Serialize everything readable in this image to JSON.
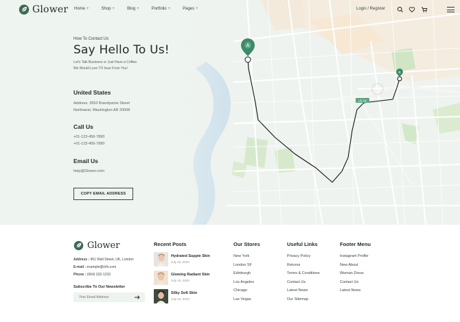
{
  "header": {
    "brand": "Glower",
    "nav": [
      {
        "label": "Home",
        "plus": "+"
      },
      {
        "label": "Shop",
        "plus": "+"
      },
      {
        "label": "Blog",
        "plus": "+"
      },
      {
        "label": "Portfolio",
        "plus": "+"
      },
      {
        "label": "Pages",
        "plus": "+"
      }
    ],
    "login": "Login / Register",
    "icons": [
      "search-icon",
      "heart-icon",
      "cart-icon",
      "menu-icon"
    ]
  },
  "contact": {
    "eyebrow": "How To Contact Us",
    "title": "Say Hello To Us!",
    "sub1": "Let's Talk Business or Just Have a Coffee.",
    "sub2": "We Would Love TO hear From You!",
    "location_title": "United States",
    "address1": "Address: 3553 Brandywine Street",
    "address2": "Northwest, Washington AR 20008",
    "call_title": "Call Us",
    "phone1": "+01-123-456-7890",
    "phone2": "+01-123-456-7890",
    "email_title": "Email Us",
    "email": "help@Glower.com",
    "copy_button": "COPY EMAIL ADDRESS"
  },
  "map": {
    "marker_a": "A",
    "marker_b": "B",
    "road_sign": "US 1tc",
    "colors": {
      "route": "#111111",
      "marker": "#3d8a6b",
      "park": "#cfe6c3",
      "water": "#c6dcec",
      "land": "#f6ead7"
    }
  },
  "footer": {
    "brand": "Glower",
    "address": {
      "label": "Address :",
      "value": "451 Wall Street, UK, London"
    },
    "email": {
      "label": "E-mail :",
      "value": "example@info.com"
    },
    "phone": {
      "label": "Phone :",
      "value": "(064) 332-1233"
    },
    "subscribe_title": "Subscribe To Our Newsletter",
    "email_placeholder": "Your Email Address",
    "recent_posts_title": "Recent Posts",
    "posts": [
      {
        "title": "Hydrated Supple Skin",
        "date": "July 23, 2023"
      },
      {
        "title": "Glowing Radiant Skin",
        "date": "July 23, 2023"
      },
      {
        "title": "Silky Soft Skin",
        "date": "July 23, 2023"
      }
    ],
    "stores_title": "Our Stores",
    "stores": [
      "New York",
      "London SF",
      "Edinburgh",
      "Los Angeles",
      "Chicago",
      "Las Vegas"
    ],
    "useful_title": "Useful Links",
    "useful": [
      "Privacy Policy",
      "Returns",
      "Terms & Conditions",
      "Contact Us",
      "Latest News",
      "Our Sitemap"
    ],
    "menu_title": "Footer Menu",
    "menu": [
      "Instagram Profile",
      "New About",
      "Woman Dress",
      "Contact Us",
      "Latest News"
    ]
  }
}
